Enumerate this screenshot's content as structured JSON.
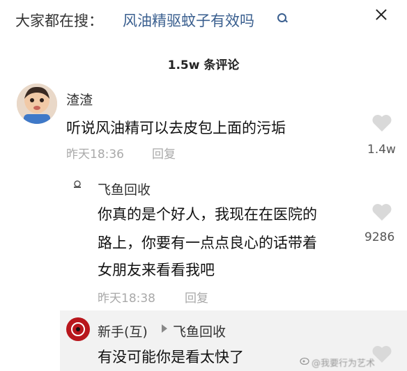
{
  "header": {
    "search_prefix": "大家都在搜：",
    "search_query": "风油精驱蚊子有效吗",
    "search_icon": "search-icon",
    "close_icon": "close-icon"
  },
  "comments_title": "1.5w 条评论",
  "comments": [
    {
      "username": "渣渣",
      "text": "听说风油精可以去皮包上面的污垢",
      "time": "昨天18:36",
      "reply_label": "回复",
      "like_count": "1.4w",
      "avatar": "baby-photo-avatar"
    }
  ],
  "replies": [
    {
      "username": "飞鱼回收",
      "lines": [
        "你真的是个好人，我现在在医院的",
        "路上，你要有一点点良心的话带着",
        "女朋友来看看我吧"
      ],
      "time": "昨天18:38",
      "reply_label": "回复",
      "like_count": "9286",
      "avatar": "small-icon-avatar"
    },
    {
      "username": "新手(互)",
      "reply_to": "飞鱼回收",
      "text": "有没可能你是看太快了",
      "avatar": "red-ring-avatar"
    }
  ],
  "watermark": "@我要行为艺术",
  "colors": {
    "link": "#3a5f8f",
    "heart": "#d9d9d9",
    "meta": "#a9a9a9",
    "reply_bg": "#f2f2f2"
  }
}
